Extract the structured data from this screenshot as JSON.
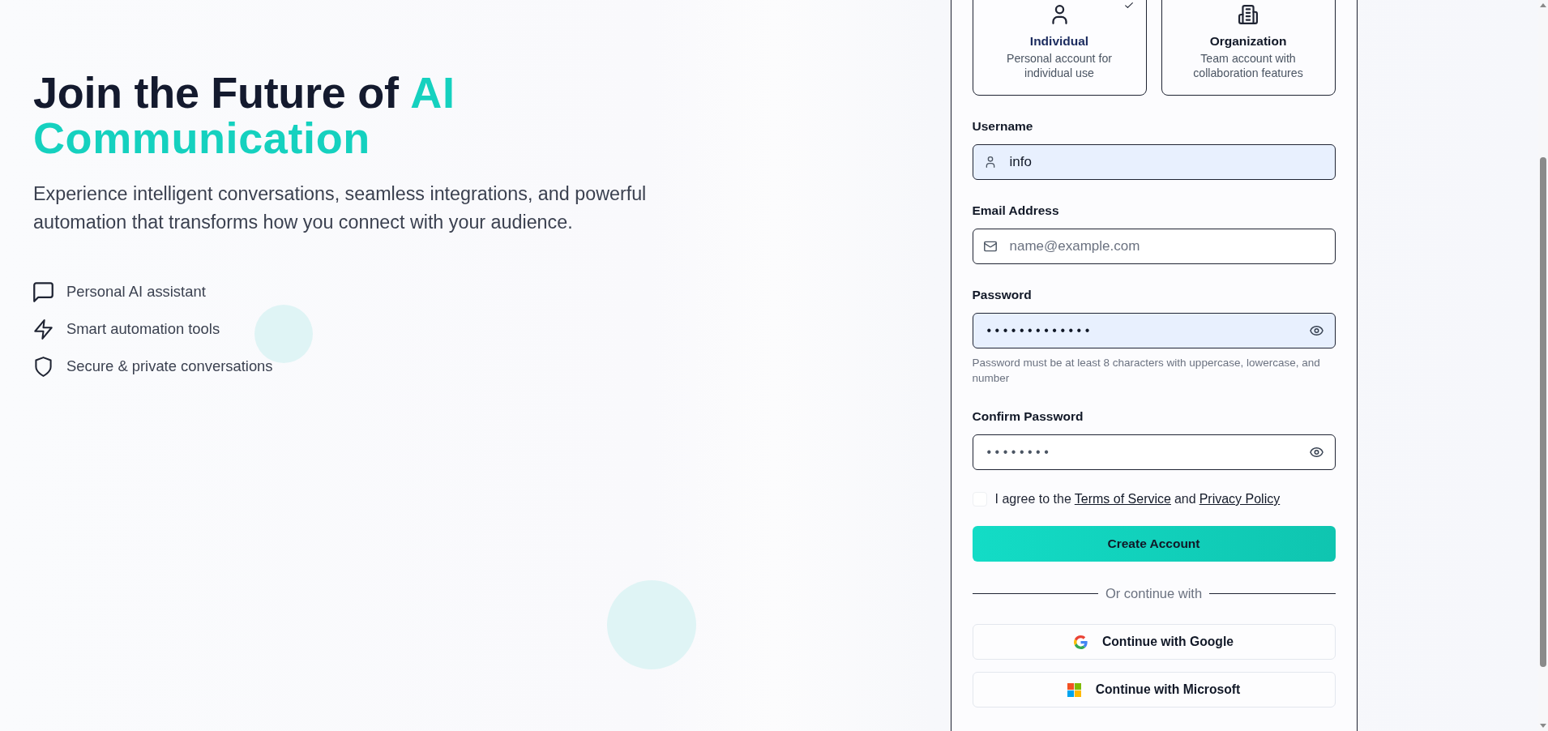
{
  "hero": {
    "title": "Join the Future of",
    "title_accent": "AI Communication",
    "subtitle": "Experience intelligent conversations, seamless integrations, and powerful automation that transforms how you connect with your audience.",
    "features": [
      {
        "kind": "chat",
        "label": "Personal AI assistant"
      },
      {
        "kind": "bolt",
        "label": "Smart automation tools"
      },
      {
        "kind": "shield",
        "label": "Secure & private conversations"
      }
    ]
  },
  "account_types": [
    {
      "kind": "individual",
      "title": "Individual",
      "description": "Personal account for individual use",
      "selected": true
    },
    {
      "kind": "organization",
      "title": "Organization",
      "description": "Team account with collaboration features",
      "selected": false
    }
  ],
  "fields": [
    {
      "kind": "username",
      "label": "Username",
      "value": "info",
      "autofilled": true
    },
    {
      "kind": "email",
      "label": "Email Address",
      "placeholder": "name@example.com",
      "autofilled": false
    },
    {
      "kind": "password",
      "label": "Password",
      "value": "•••••••••••••",
      "autofilled": true,
      "hint": "Password must be at least 8 characters with uppercase, lowercase, and number"
    },
    {
      "kind": "password",
      "label": "Confirm Password",
      "value": "••••••••",
      "autofilled": false
    }
  ],
  "terms": {
    "checked": false,
    "segments": [
      {
        "kind": "text",
        "text": "I agree to the"
      },
      {
        "kind": "link",
        "text": "Terms of Service"
      },
      {
        "kind": "text",
        "text": "and"
      },
      {
        "kind": "link",
        "text": "Privacy Policy"
      }
    ]
  },
  "submit": {
    "label": "Create Account"
  },
  "divider": {
    "label": "Or continue with"
  },
  "social_buttons": [
    {
      "kind": "google",
      "label": "Continue with Google"
    },
    {
      "kind": "microsoft",
      "label": "Continue with Microsoft"
    }
  ]
}
